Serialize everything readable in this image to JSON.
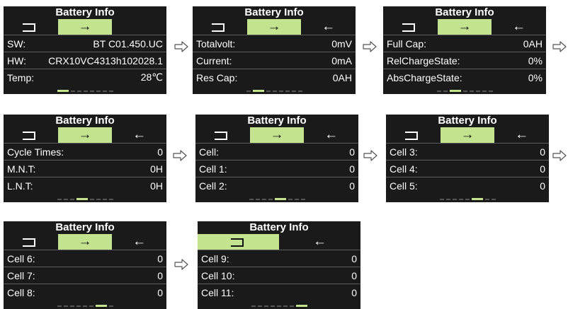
{
  "title": "Battery Info",
  "colors": {
    "screen_bg": "#1a1a1a",
    "highlight": "#c3e38f",
    "divider": "#5a5a5a",
    "text": "#ffffff"
  },
  "icons": {
    "back": "return-icon",
    "forward": "arrow-right-icon",
    "previous": "arrow-left-icon",
    "flow": "hollow-arrow-right-icon"
  },
  "arrows": {
    "forward": "→",
    "previous": "←"
  },
  "screens": [
    {
      "nav": [
        "back",
        "forward",
        ""
      ],
      "active": 1,
      "page_index": 0,
      "rows": [
        {
          "label": "SW:",
          "value": "BT C01.450.UC"
        },
        {
          "label": "HW:",
          "value": "CRX10VC4313h102028.1"
        },
        {
          "label": "Temp:",
          "value": "28℃"
        }
      ]
    },
    {
      "nav": [
        "back",
        "forward",
        "previous"
      ],
      "active": 1,
      "page_index": 1,
      "rows": [
        {
          "label": "Totalvolt:",
          "value": "0mV"
        },
        {
          "label": "Current:",
          "value": "0mA"
        },
        {
          "label": "Res Cap:",
          "value": "0AH"
        }
      ]
    },
    {
      "nav": [
        "back",
        "forward",
        "previous"
      ],
      "active": 1,
      "page_index": 2,
      "rows": [
        {
          "label": "Full Cap:",
          "value": "0AH"
        },
        {
          "label": "RelChargeState:",
          "value": "0%"
        },
        {
          "label": "AbsChargeState:",
          "value": "0%"
        }
      ]
    },
    {
      "nav": [
        "back",
        "forward",
        "previous"
      ],
      "active": 1,
      "page_index": 3,
      "rows": [
        {
          "label": "Cycle Times:",
          "value": "0"
        },
        {
          "label": "M.N.T:",
          "value": "0H"
        },
        {
          "label": "L.N.T:",
          "value": "0H"
        }
      ]
    },
    {
      "nav": [
        "back",
        "forward",
        "previous"
      ],
      "active": 1,
      "page_index": 4,
      "rows": [
        {
          "label": "Cell:",
          "value": "0"
        },
        {
          "label": "Cell 1:",
          "value": "0"
        },
        {
          "label": "Cell 2:",
          "value": "0"
        }
      ]
    },
    {
      "nav": [
        "back",
        "forward",
        "previous"
      ],
      "active": 1,
      "page_index": 5,
      "rows": [
        {
          "label": "Cell 3:",
          "value": "0"
        },
        {
          "label": "Cell 4:",
          "value": "0"
        },
        {
          "label": "Cell 5:",
          "value": "0"
        }
      ]
    },
    {
      "nav": [
        "back",
        "forward",
        "previous"
      ],
      "active": 1,
      "page_index": 6,
      "rows": [
        {
          "label": "Cell 6:",
          "value": "0"
        },
        {
          "label": "Cell 7:",
          "value": "0"
        },
        {
          "label": "Cell 8:",
          "value": "0"
        }
      ]
    },
    {
      "nav": [
        "back",
        "previous"
      ],
      "active": 0,
      "page_index": 7,
      "rows": [
        {
          "label": "Cell 9:",
          "value": "0"
        },
        {
          "label": "Cell 10:",
          "value": "0"
        },
        {
          "label": "Cell 11:",
          "value": "0"
        }
      ]
    }
  ],
  "page_count": 8
}
